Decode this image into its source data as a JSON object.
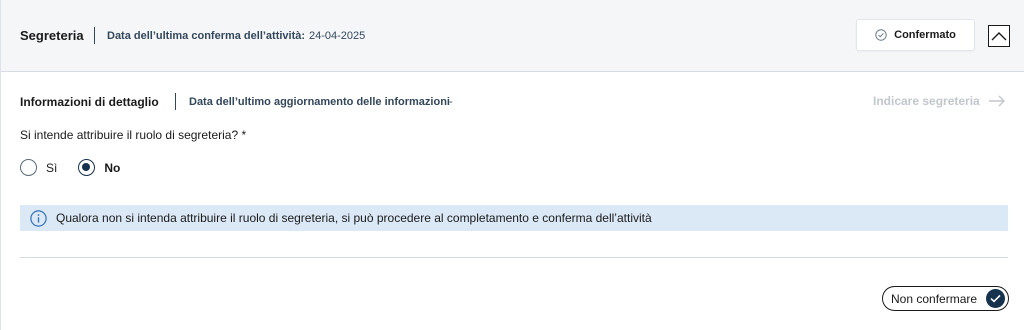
{
  "header": {
    "title": "Segreteria",
    "last_confirmation_label": "Data dell’ultima conferma dell’attività:",
    "last_confirmation_value": "24-04-2025",
    "status_button_label": "Confermato",
    "status_icon": "check-circle-icon",
    "collapse_icon": "chevron-up-icon"
  },
  "detail": {
    "title": "Informazioni di dettaglio",
    "last_update_label": "Data dell’ultimo aggiornamento delle informazioni",
    "last_update_value": "-",
    "action_link_label": "Indicare segreteria",
    "action_link_icon": "arrow-right-icon"
  },
  "question": {
    "text": "Si intende attribuire il ruolo di segreteria? *",
    "options": [
      {
        "label": "Sì",
        "checked": false
      },
      {
        "label": "No",
        "checked": true
      }
    ]
  },
  "info_notice": {
    "icon": "info-icon",
    "text": "Qualora non si intenda attribuire il ruolo di segreteria, si può procedere al completamento e conferma dell’attività"
  },
  "footer": {
    "unconfirm_button_label": "Non confermare",
    "unconfirm_icon": "check-icon"
  },
  "colors": {
    "primary": "#17324d",
    "info_bg": "#dbe9f6",
    "header_bg": "#f5f6f8",
    "disabled_text": "#c2c7cd"
  }
}
